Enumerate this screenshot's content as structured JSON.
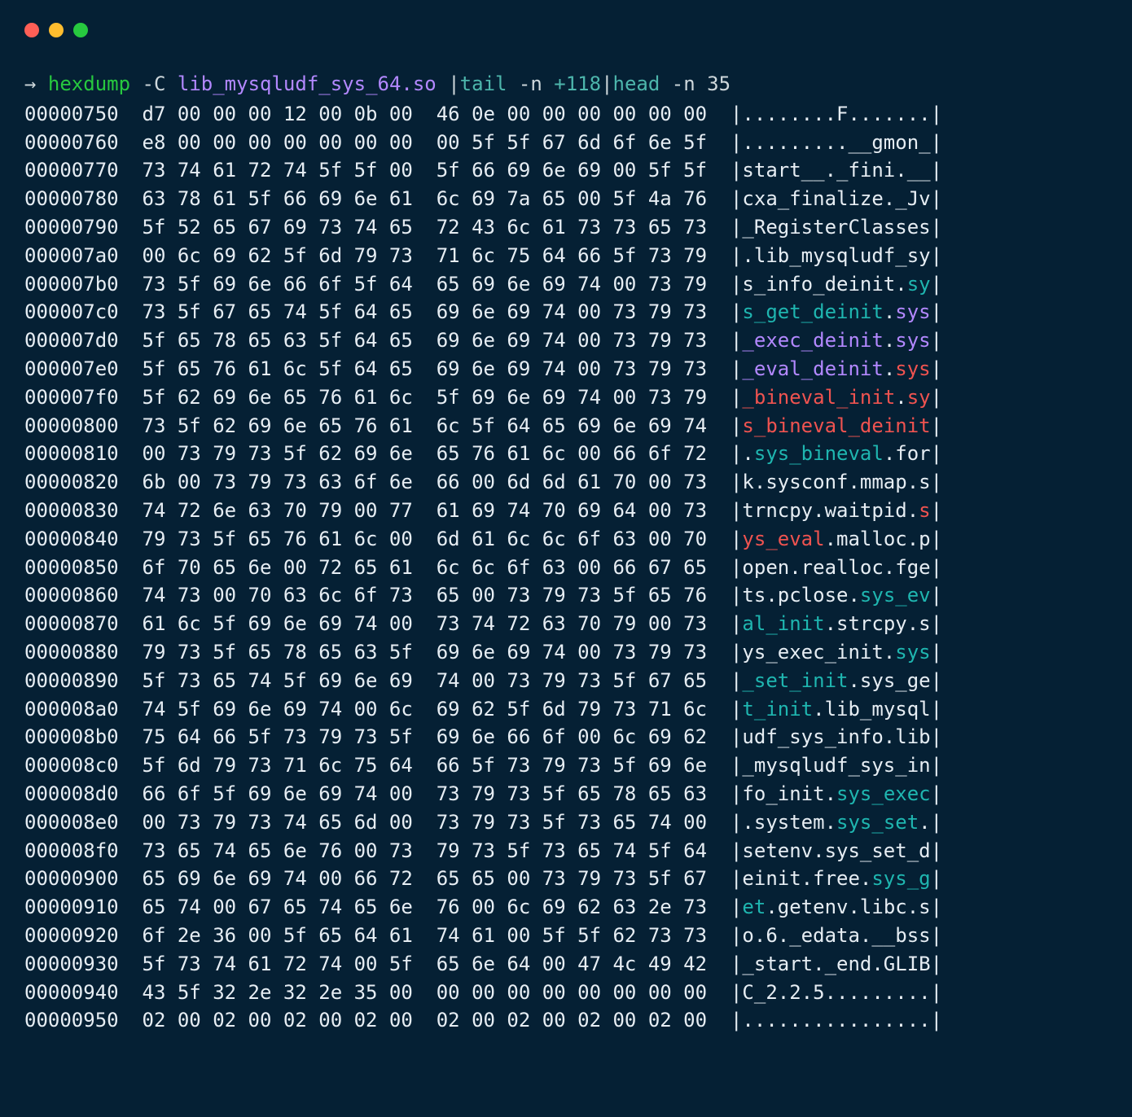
{
  "prompt": {
    "arrow": "→",
    "cmd": "hexdump",
    "flag": "-C",
    "file": "lib_mysqludf_sys_64.so",
    "pipe1_cmd": "tail",
    "pipe1_flag": "-n",
    "pipe1_num": "+118",
    "pipe2_cmd": "head",
    "pipe2_flag": "-n",
    "pipe2_arg": "35"
  },
  "lines": [
    {
      "addr": "00000750",
      "hex": "d7 00 00 00 12 00 0b 00  46 0e 00 00 00 00 00 00",
      "asc": [
        {
          "t": "|........F.......|"
        }
      ]
    },
    {
      "addr": "00000760",
      "hex": "e8 00 00 00 00 00 00 00  00 5f 5f 67 6d 6f 6e 5f",
      "asc": [
        {
          "t": "|.........__gmon_|"
        }
      ]
    },
    {
      "addr": "00000770",
      "hex": "73 74 61 72 74 5f 5f 00  5f 66 69 6e 69 00 5f 5f",
      "asc": [
        {
          "t": "|start__._fini.__|"
        }
      ]
    },
    {
      "addr": "00000780",
      "hex": "63 78 61 5f 66 69 6e 61  6c 69 7a 65 00 5f 4a 76",
      "asc": [
        {
          "t": "|cxa_finalize._Jv|"
        }
      ]
    },
    {
      "addr": "00000790",
      "hex": "5f 52 65 67 69 73 74 65  72 43 6c 61 73 73 65 73",
      "asc": [
        {
          "t": "|_RegisterClasses|"
        }
      ]
    },
    {
      "addr": "000007a0",
      "hex": "00 6c 69 62 5f 6d 79 73  71 6c 75 64 66 5f 73 79",
      "asc": [
        {
          "t": "|.lib_mysqludf_sy|"
        }
      ]
    },
    {
      "addr": "000007b0",
      "hex": "73 5f 69 6e 66 6f 5f 64  65 69 6e 69 74 00 73 79",
      "asc": [
        {
          "t": "|s_info_deinit."
        },
        {
          "t": "sy",
          "c": "sg"
        },
        {
          "t": "|"
        }
      ]
    },
    {
      "addr": "000007c0",
      "hex": "73 5f 67 65 74 5f 64 65  69 6e 69 74 00 73 79 73",
      "asc": [
        {
          "t": "|"
        },
        {
          "t": "s_get_deinit",
          "c": "sg"
        },
        {
          "t": "."
        },
        {
          "t": "sys",
          "c": "sp"
        },
        {
          "t": "|"
        }
      ]
    },
    {
      "addr": "000007d0",
      "hex": "5f 65 78 65 63 5f 64 65  69 6e 69 74 00 73 79 73",
      "asc": [
        {
          "t": "|"
        },
        {
          "t": "_exec_deinit",
          "c": "sp"
        },
        {
          "t": "."
        },
        {
          "t": "sys",
          "c": "sp"
        },
        {
          "t": "|"
        }
      ]
    },
    {
      "addr": "000007e0",
      "hex": "5f 65 76 61 6c 5f 64 65  69 6e 69 74 00 73 79 73",
      "asc": [
        {
          "t": "|"
        },
        {
          "t": "_eval_deinit",
          "c": "sp"
        },
        {
          "t": "."
        },
        {
          "t": "sys",
          "c": "sr"
        },
        {
          "t": "|"
        }
      ]
    },
    {
      "addr": "000007f0",
      "hex": "5f 62 69 6e 65 76 61 6c  5f 69 6e 69 74 00 73 79",
      "asc": [
        {
          "t": "|"
        },
        {
          "t": "_bineval_init",
          "c": "sr"
        },
        {
          "t": "."
        },
        {
          "t": "sy",
          "c": "sr"
        },
        {
          "t": "|"
        }
      ]
    },
    {
      "addr": "00000800",
      "hex": "73 5f 62 69 6e 65 76 61  6c 5f 64 65 69 6e 69 74",
      "asc": [
        {
          "t": "|"
        },
        {
          "t": "s_bineval_deinit",
          "c": "sr"
        },
        {
          "t": "|"
        }
      ]
    },
    {
      "addr": "00000810",
      "hex": "00 73 79 73 5f 62 69 6e  65 76 61 6c 00 66 6f 72",
      "asc": [
        {
          "t": "|."
        },
        {
          "t": "sys_bineval",
          "c": "sg"
        },
        {
          "t": ".for|"
        }
      ]
    },
    {
      "addr": "00000820",
      "hex": "6b 00 73 79 73 63 6f 6e  66 00 6d 6d 61 70 00 73",
      "asc": [
        {
          "t": "|k.sysconf.mmap.s|"
        }
      ]
    },
    {
      "addr": "00000830",
      "hex": "74 72 6e 63 70 79 00 77  61 69 74 70 69 64 00 73",
      "asc": [
        {
          "t": "|trncpy.waitpid."
        },
        {
          "t": "s",
          "c": "sr"
        },
        {
          "t": "|"
        }
      ]
    },
    {
      "addr": "00000840",
      "hex": "79 73 5f 65 76 61 6c 00  6d 61 6c 6c 6f 63 00 70",
      "asc": [
        {
          "t": "|"
        },
        {
          "t": "ys_eval",
          "c": "sr"
        },
        {
          "t": ".malloc.p|"
        }
      ]
    },
    {
      "addr": "00000850",
      "hex": "6f 70 65 6e 00 72 65 61  6c 6c 6f 63 00 66 67 65",
      "asc": [
        {
          "t": "|open.realloc.fge|"
        }
      ]
    },
    {
      "addr": "00000860",
      "hex": "74 73 00 70 63 6c 6f 73  65 00 73 79 73 5f 65 76",
      "asc": [
        {
          "t": "|ts.pclose."
        },
        {
          "t": "sys_ev",
          "c": "sg"
        },
        {
          "t": "|"
        }
      ]
    },
    {
      "addr": "00000870",
      "hex": "61 6c 5f 69 6e 69 74 00  73 74 72 63 70 79 00 73",
      "asc": [
        {
          "t": "|"
        },
        {
          "t": "al_init",
          "c": "sg"
        },
        {
          "t": ".strcpy.s|"
        }
      ]
    },
    {
      "addr": "00000880",
      "hex": "79 73 5f 65 78 65 63 5f  69 6e 69 74 00 73 79 73",
      "asc": [
        {
          "t": "|ys_exec_init."
        },
        {
          "t": "sys",
          "c": "sg"
        },
        {
          "t": "|"
        }
      ]
    },
    {
      "addr": "00000890",
      "hex": "5f 73 65 74 5f 69 6e 69  74 00 73 79 73 5f 67 65",
      "asc": [
        {
          "t": "|"
        },
        {
          "t": "_set_init",
          "c": "sg"
        },
        {
          "t": ".sys_ge|"
        }
      ]
    },
    {
      "addr": "000008a0",
      "hex": "74 5f 69 6e 69 74 00 6c  69 62 5f 6d 79 73 71 6c",
      "asc": [
        {
          "t": "|"
        },
        {
          "t": "t_init",
          "c": "sg"
        },
        {
          "t": ".lib_mysql|"
        }
      ]
    },
    {
      "addr": "000008b0",
      "hex": "75 64 66 5f 73 79 73 5f  69 6e 66 6f 00 6c 69 62",
      "asc": [
        {
          "t": "|udf_sys_info.lib|"
        }
      ]
    },
    {
      "addr": "000008c0",
      "hex": "5f 6d 79 73 71 6c 75 64  66 5f 73 79 73 5f 69 6e",
      "asc": [
        {
          "t": "|_mysqludf_sys_in|"
        }
      ]
    },
    {
      "addr": "000008d0",
      "hex": "66 6f 5f 69 6e 69 74 00  73 79 73 5f 65 78 65 63",
      "asc": [
        {
          "t": "|fo_init."
        },
        {
          "t": "sys_exec",
          "c": "sg"
        },
        {
          "t": "|"
        }
      ]
    },
    {
      "addr": "000008e0",
      "hex": "00 73 79 73 74 65 6d 00  73 79 73 5f 73 65 74 00",
      "asc": [
        {
          "t": "|.system."
        },
        {
          "t": "sys_set",
          "c": "sg"
        },
        {
          "t": ".|"
        }
      ]
    },
    {
      "addr": "000008f0",
      "hex": "73 65 74 65 6e 76 00 73  79 73 5f 73 65 74 5f 64",
      "asc": [
        {
          "t": "|setenv.sys_set_d|"
        }
      ]
    },
    {
      "addr": "00000900",
      "hex": "65 69 6e 69 74 00 66 72  65 65 00 73 79 73 5f 67",
      "asc": [
        {
          "t": "|einit.free."
        },
        {
          "t": "sys_g",
          "c": "sg"
        },
        {
          "t": "|"
        }
      ]
    },
    {
      "addr": "00000910",
      "hex": "65 74 00 67 65 74 65 6e  76 00 6c 69 62 63 2e 73",
      "asc": [
        {
          "t": "|"
        },
        {
          "t": "et",
          "c": "sg"
        },
        {
          "t": ".getenv.libc.s|"
        }
      ]
    },
    {
      "addr": "00000920",
      "hex": "6f 2e 36 00 5f 65 64 61  74 61 00 5f 5f 62 73 73",
      "asc": [
        {
          "t": "|o.6._edata.__bss|"
        }
      ]
    },
    {
      "addr": "00000930",
      "hex": "5f 73 74 61 72 74 00 5f  65 6e 64 00 47 4c 49 42",
      "asc": [
        {
          "t": "|_start._end.GLIB|"
        }
      ]
    },
    {
      "addr": "00000940",
      "hex": "43 5f 32 2e 32 2e 35 00  00 00 00 00 00 00 00 00",
      "asc": [
        {
          "t": "|C_2.2.5.........|"
        }
      ]
    },
    {
      "addr": "00000950",
      "hex": "02 00 02 00 02 00 02 00  02 00 02 00 02 00 02 00",
      "asc": [
        {
          "t": "|................|"
        }
      ]
    }
  ]
}
